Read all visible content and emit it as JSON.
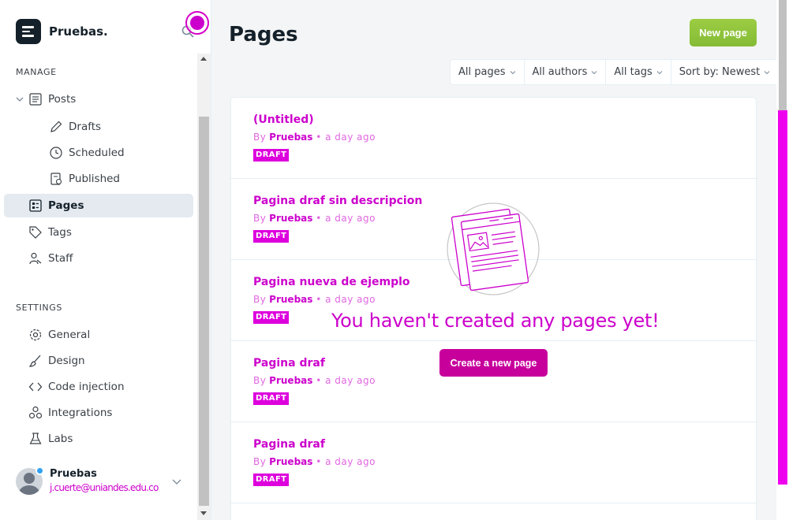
{
  "brand": {
    "name": "Pruebas."
  },
  "sidebar": {
    "manage_label": "MANAGE",
    "settings_label": "SETTINGS",
    "items": [
      {
        "label": "Posts",
        "icon": "posts-icon"
      },
      {
        "label": "Drafts",
        "icon": "pencil-icon"
      },
      {
        "label": "Scheduled",
        "icon": "clock-icon"
      },
      {
        "label": "Published",
        "icon": "published-icon"
      },
      {
        "label": "Pages",
        "icon": "pages-icon",
        "active": true
      },
      {
        "label": "Tags",
        "icon": "tag-icon"
      },
      {
        "label": "Staff",
        "icon": "staff-icon"
      }
    ],
    "settings": [
      {
        "label": "General",
        "icon": "gear-icon"
      },
      {
        "label": "Design",
        "icon": "brush-icon"
      },
      {
        "label": "Code injection",
        "icon": "code-icon"
      },
      {
        "label": "Integrations",
        "icon": "integrations-icon"
      },
      {
        "label": "Labs",
        "icon": "flask-icon"
      }
    ]
  },
  "user": {
    "name": "Pruebas",
    "email": "j.cuerte@uniandes.edu.co"
  },
  "main": {
    "title": "Pages",
    "new_page_label": "New page",
    "filters": [
      "All pages",
      "All authors",
      "All tags",
      "Sort by: Newest"
    ],
    "rows": [
      {
        "title": "(Untitled)",
        "by": "By",
        "author": "Pruebas",
        "time": "• a day ago",
        "status": "DRAFT"
      },
      {
        "title": "Pagina draf sin descripcion",
        "by": "By",
        "author": "Pruebas",
        "time": "• a day ago",
        "status": "DRAFT"
      },
      {
        "title": "Pagina nueva de ejemplo",
        "by": "By",
        "author": "Pruebas",
        "time": "• a day ago",
        "status": "DRAFT"
      },
      {
        "title": "Pagina draf",
        "by": "By",
        "author": "Pruebas",
        "time": "• a day ago",
        "status": "DRAFT"
      },
      {
        "title": "Pagina draf",
        "by": "By",
        "author": "Pruebas",
        "time": "• a day ago",
        "status": "DRAFT"
      }
    ]
  },
  "empty_state": {
    "message": "You haven't created any pages yet!",
    "button_label": "Create a new page"
  },
  "colors": {
    "accent_green": "#9ccd43",
    "highlight_magenta": "#cc00cc",
    "button_magenta": "#c7009c",
    "active_nav_bg": "#e5eaf1"
  }
}
